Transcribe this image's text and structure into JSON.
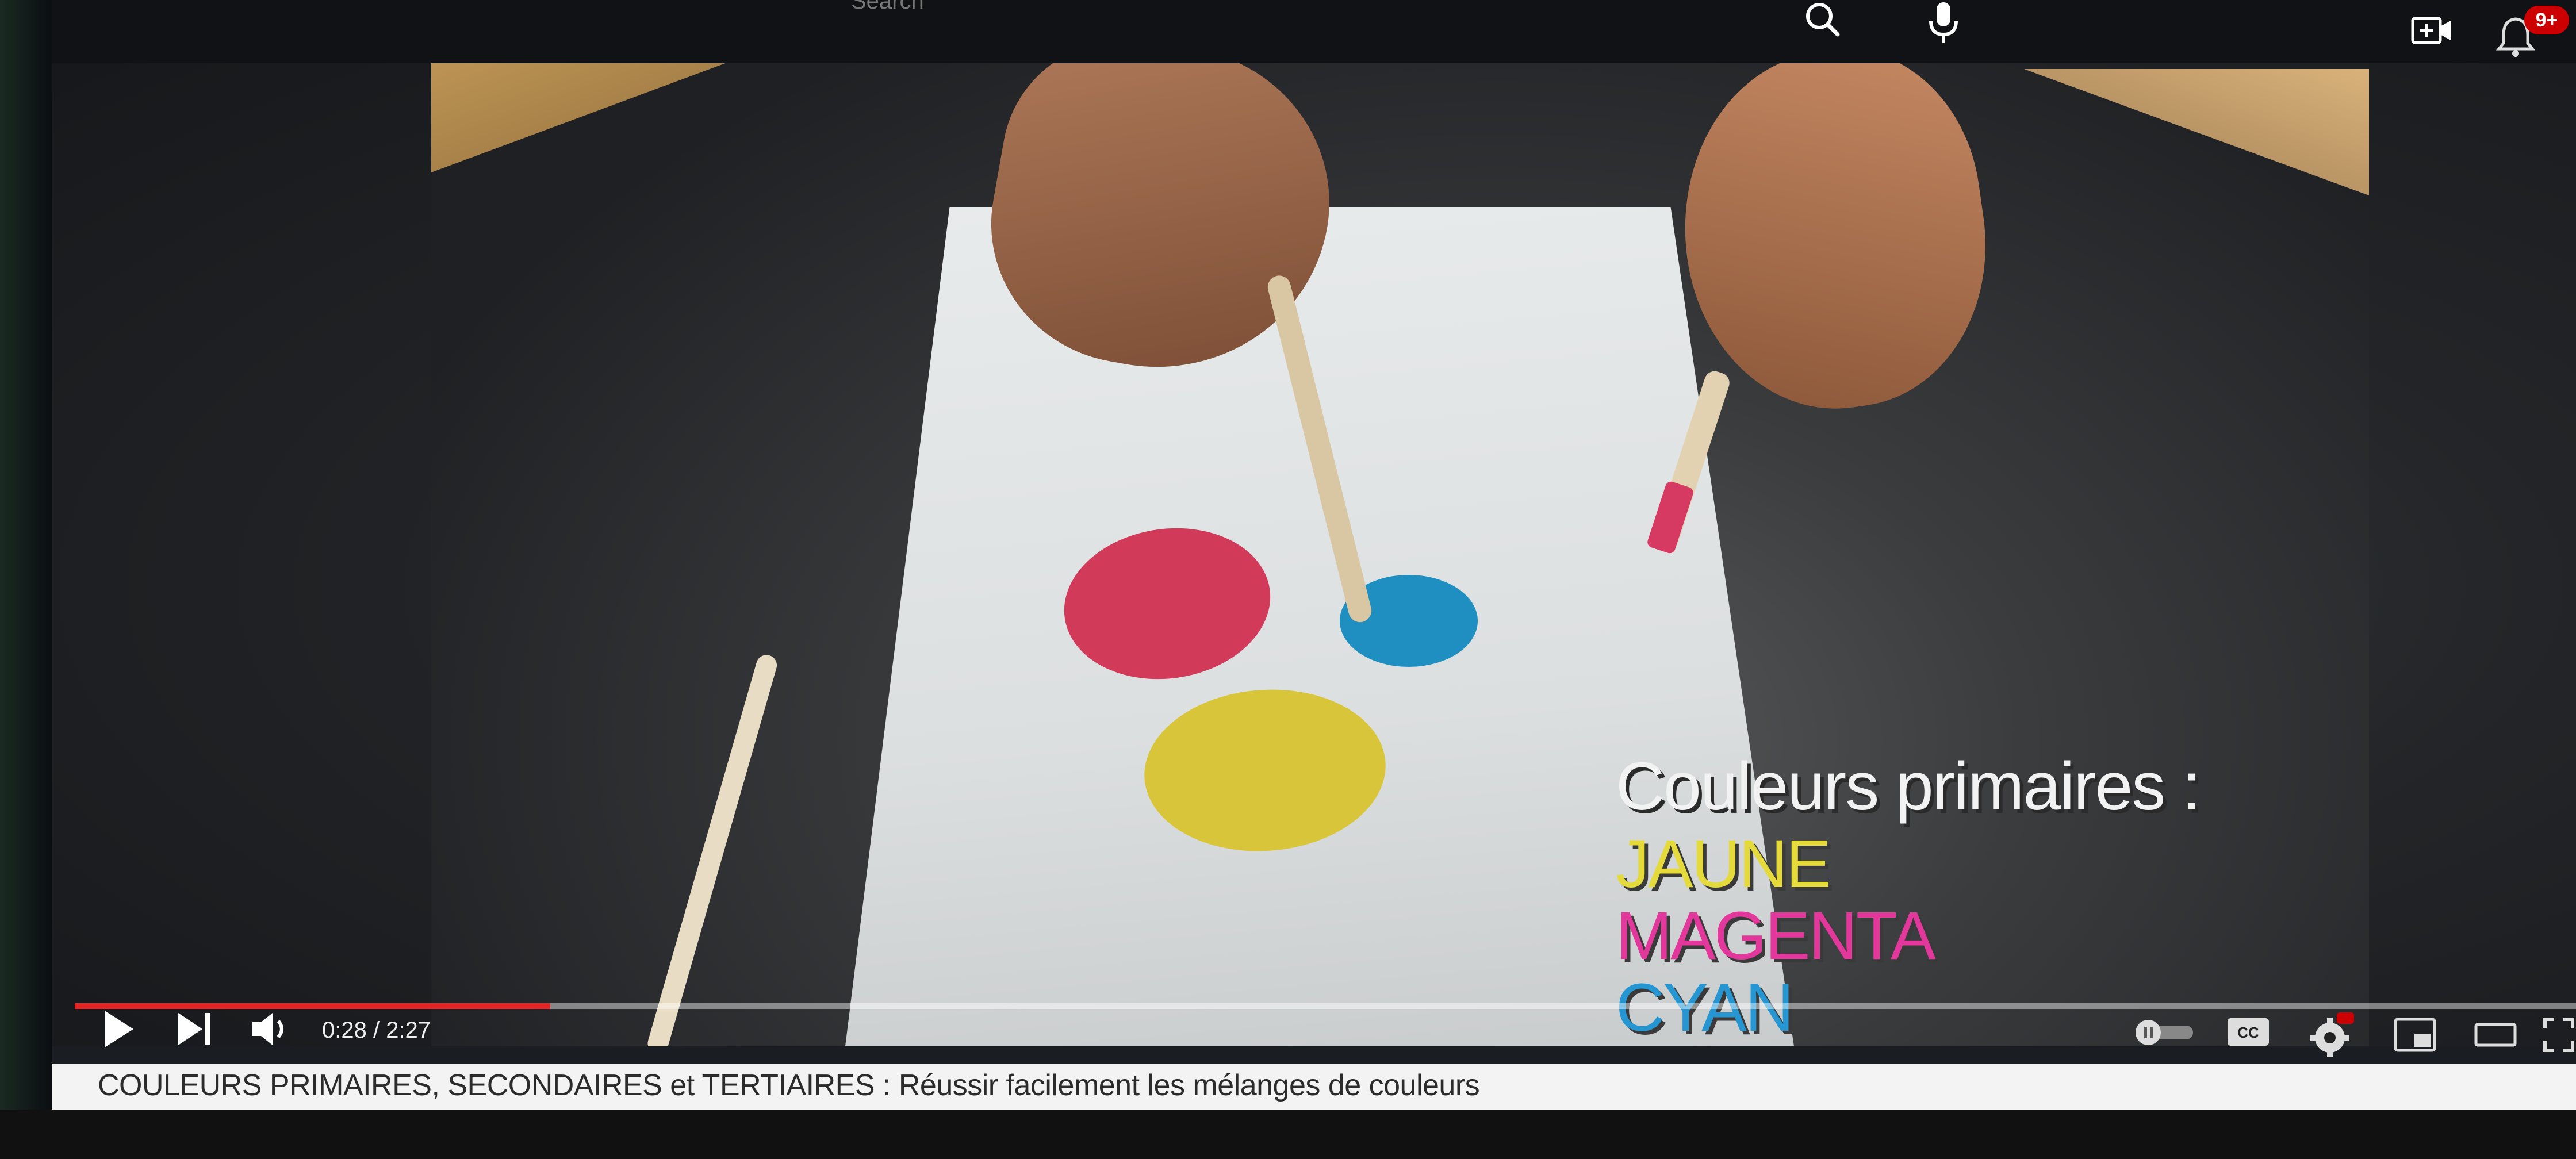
{
  "header": {
    "search_placeholder": "Search",
    "notification_count": "9+"
  },
  "video": {
    "overlay": {
      "heading": "Couleurs primaires :",
      "colors": [
        "JAUNE",
        "MAGENTA",
        "CYAN"
      ],
      "color_hex": [
        "#e4da3c",
        "#e3389b",
        "#2596d2"
      ]
    },
    "progress_fraction": 0.19
  },
  "player": {
    "time": "0:28 / 2:27"
  },
  "details": {
    "title": "COULEURS PRIMAIRES, SECONDAIRES et TERTIAIRES : Réussir facilement les mélanges de couleurs"
  },
  "colors": {
    "accent": "#e32424",
    "badge": "#cc0000"
  },
  "icons": [
    "search-icon",
    "mic-icon",
    "create-icon",
    "bell-icon",
    "play-icon",
    "next-icon",
    "volume-icon",
    "autoplay-icon",
    "cc-icon",
    "settings-icon",
    "miniplayer-icon",
    "theater-icon",
    "fullscreen-icon"
  ]
}
